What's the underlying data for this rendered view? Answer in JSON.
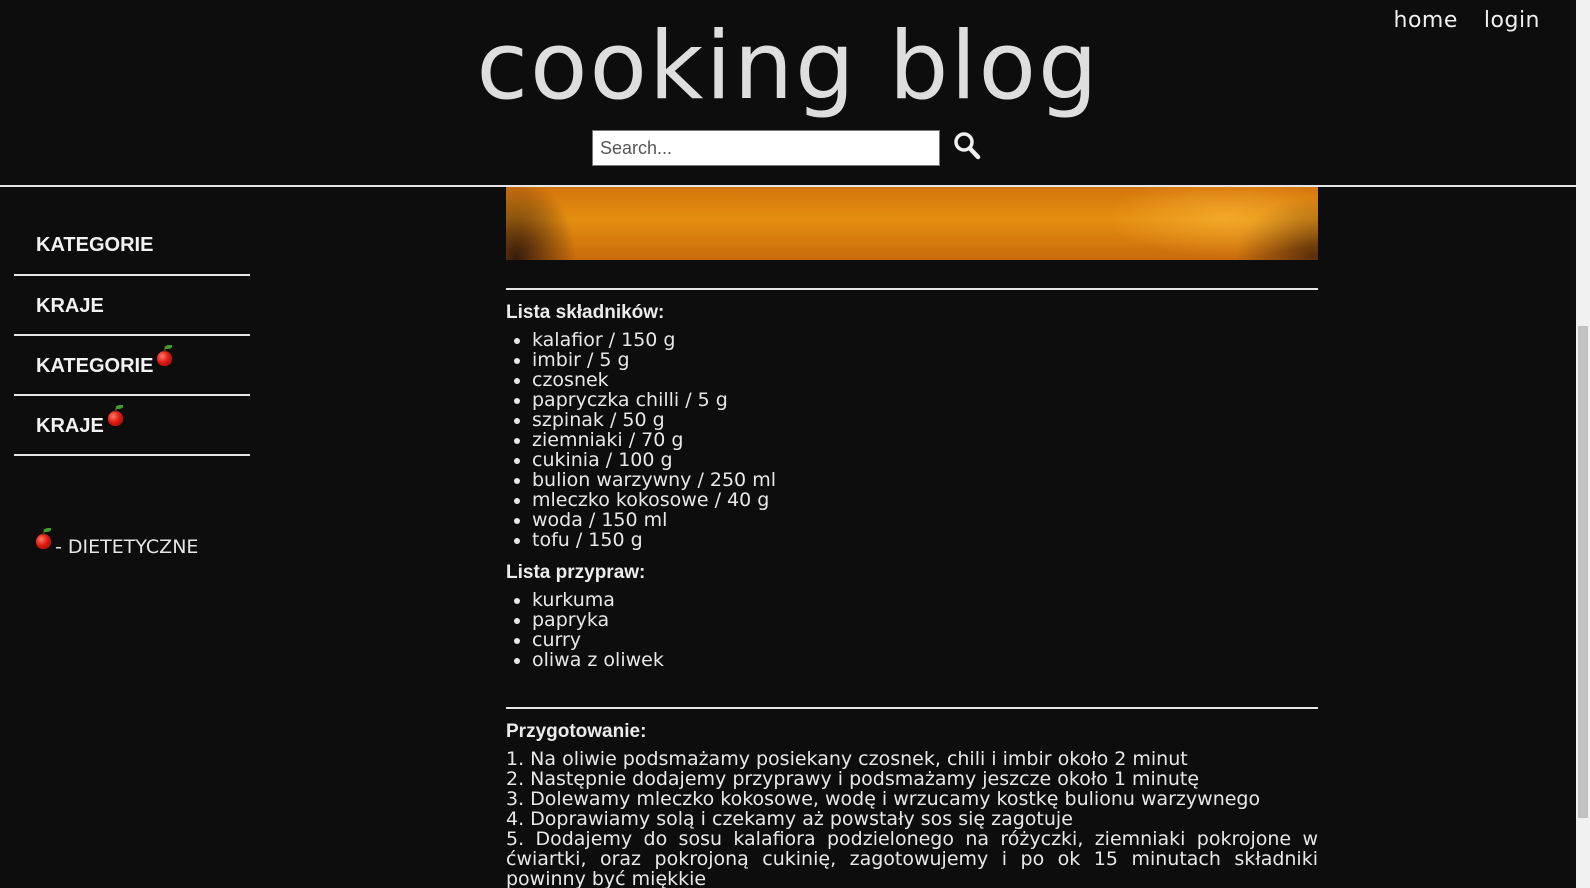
{
  "header": {
    "site_title": "cooking blog",
    "nav": {
      "home": "home",
      "login": "login"
    },
    "search": {
      "placeholder": "Search...",
      "value": ""
    }
  },
  "sidebar": {
    "items": [
      {
        "label": "KATEGORIE",
        "dietary": false
      },
      {
        "label": "KRAJE",
        "dietary": false
      },
      {
        "label": "KATEGORIE",
        "dietary": true
      },
      {
        "label": "KRAJE",
        "dietary": true
      }
    ],
    "legend": "- DIETETYCZNE"
  },
  "recipe": {
    "ingredients_title": "Lista składników:",
    "ingredients": [
      "kalafior / 150 g",
      "imbir / 5 g",
      "czosnek",
      "papryczka chilli / 5 g",
      "szpinak / 50 g",
      "ziemniaki / 70 g",
      "cukinia / 100 g",
      "bulion warzywny / 250 ml",
      "mleczko kokosowe / 40 g",
      "woda / 150 ml",
      "tofu / 150 g"
    ],
    "spices_title": "Lista przypraw:",
    "spices": [
      "kurkuma",
      "papryka",
      "curry",
      "oliwa z oliwek"
    ],
    "preparation_title": "Przygotowanie:",
    "steps": [
      "1. Na oliwie podsmażamy posiekany czosnek, chili i imbir około 2 minut",
      "2. Następnie dodajemy przyprawy i podsmażamy jeszcze około 1 minutę",
      "3. Dolewamy mleczko kokosowe, wodę i wrzucamy kostkę bulionu warzywnego",
      "4. Doprawiamy solą i czekamy aż powstały sos się zagotuje",
      "5. Dodajemy do sosu kalafiora podzielonego na różyczki, ziemniaki pokrojone w ćwiartki, oraz pokrojoną cukinię, zagotowujemy i po ok 15 minutach składniki powinny być miękkie"
    ]
  },
  "icons": {
    "search": "search-icon",
    "dietary": "apple-icon"
  }
}
